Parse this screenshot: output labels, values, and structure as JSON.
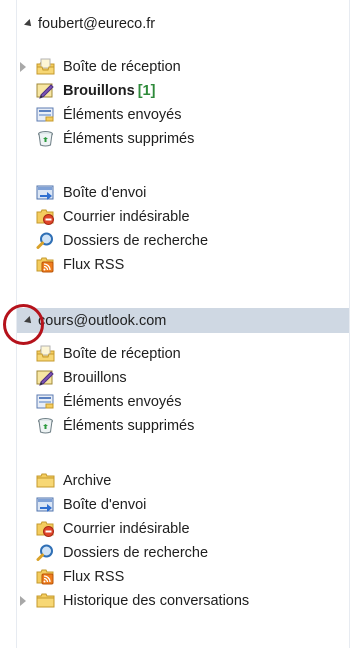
{
  "accounts": [
    {
      "email": "foubert@eureco.fr",
      "folders": [
        {
          "label": "Boîte de réception",
          "icon": "inbox-icon",
          "expandable": true
        },
        {
          "label": "Brouillons",
          "icon": "drafts-icon",
          "bold": true,
          "count": "[1]"
        },
        {
          "label": "Éléments envoyés",
          "icon": "sent-items-icon"
        },
        {
          "label": "Éléments supprimés",
          "icon": "deleted-items-icon"
        },
        {
          "label": "Boîte d'envoi",
          "icon": "outbox-icon"
        },
        {
          "label": "Courrier indésirable",
          "icon": "junk-mail-icon"
        },
        {
          "label": "Dossiers de recherche",
          "icon": "search-folders-icon"
        },
        {
          "label": "Flux RSS",
          "icon": "rss-feeds-icon"
        }
      ]
    },
    {
      "email": "cours@outlook.com",
      "folders": [
        {
          "label": "Boîte de réception",
          "icon": "inbox-icon"
        },
        {
          "label": "Brouillons",
          "icon": "drafts-icon"
        },
        {
          "label": "Éléments envoyés",
          "icon": "sent-items-icon"
        },
        {
          "label": "Éléments supprimés",
          "icon": "deleted-items-icon"
        },
        {
          "label": "Archive",
          "icon": "archive-folder-icon"
        },
        {
          "label": "Boîte d'envoi",
          "icon": "outbox-icon"
        },
        {
          "label": "Courrier indésirable",
          "icon": "junk-mail-icon"
        },
        {
          "label": "Dossiers de recherche",
          "icon": "search-folders-icon"
        },
        {
          "label": "Flux RSS",
          "icon": "rss-feeds-icon"
        },
        {
          "label": "Historique des conversations",
          "icon": "folder-icon",
          "expandable": true
        }
      ]
    }
  ],
  "colors": {
    "selected_account_bg": "#cfd8e3",
    "unread_count": "#2e8a3a",
    "highlight_circle": "#b5121b",
    "folder_yellow": "#f4cc5e"
  }
}
